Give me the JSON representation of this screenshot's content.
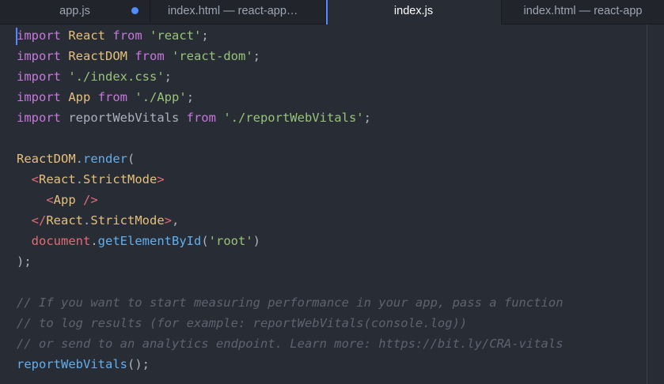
{
  "tabs": [
    {
      "label": "app.js",
      "modified": true,
      "active": false
    },
    {
      "label": "index.html — react-app₩p...",
      "modified": false,
      "active": false
    },
    {
      "label": "index.js",
      "modified": false,
      "active": true
    },
    {
      "label": "index.html — react-app",
      "modified": false,
      "active": false
    }
  ],
  "colors": {
    "background": "#282c34",
    "tabbar": "#21252b",
    "keyword": "#c678dd",
    "string": "#98c379",
    "identifier": "#e5c07b",
    "function": "#61afef",
    "tag": "#e06c75",
    "comment": "#5c6370",
    "cursor": "#528bff"
  },
  "code_lines": [
    [
      [
        "kw",
        "import"
      ],
      [
        "pun",
        " "
      ],
      [
        "var",
        "React"
      ],
      [
        "pun",
        " "
      ],
      [
        "kw",
        "from"
      ],
      [
        "pun",
        " "
      ],
      [
        "str",
        "'react'"
      ],
      [
        "pun",
        ";"
      ]
    ],
    [
      [
        "kw",
        "import"
      ],
      [
        "pun",
        " "
      ],
      [
        "var",
        "ReactDOM"
      ],
      [
        "pun",
        " "
      ],
      [
        "kw",
        "from"
      ],
      [
        "pun",
        " "
      ],
      [
        "str",
        "'react-dom'"
      ],
      [
        "pun",
        ";"
      ]
    ],
    [
      [
        "kw",
        "import"
      ],
      [
        "pun",
        " "
      ],
      [
        "str",
        "'./index.css'"
      ],
      [
        "pun",
        ";"
      ]
    ],
    [
      [
        "kw",
        "import"
      ],
      [
        "pun",
        " "
      ],
      [
        "var",
        "App"
      ],
      [
        "pun",
        " "
      ],
      [
        "kw",
        "from"
      ],
      [
        "pun",
        " "
      ],
      [
        "str",
        "'./App'"
      ],
      [
        "pun",
        ";"
      ]
    ],
    [
      [
        "kw",
        "import"
      ],
      [
        "pun",
        " reportWebVitals "
      ],
      [
        "kw",
        "from"
      ],
      [
        "pun",
        " "
      ],
      [
        "str",
        "'./reportWebVitals'"
      ],
      [
        "pun",
        ";"
      ]
    ],
    [],
    [
      [
        "var",
        "ReactDOM"
      ],
      [
        "pun",
        "."
      ],
      [
        "fn",
        "render"
      ],
      [
        "pun",
        "("
      ]
    ],
    [
      [
        "pun",
        "  "
      ],
      [
        "tag",
        "<"
      ],
      [
        "var",
        "React"
      ],
      [
        "pun",
        "."
      ],
      [
        "var",
        "StrictMode"
      ],
      [
        "tag",
        ">"
      ]
    ],
    [
      [
        "pun",
        "    "
      ],
      [
        "tag",
        "<"
      ],
      [
        "var",
        "App"
      ],
      [
        "pun",
        " "
      ],
      [
        "tag",
        "/>"
      ]
    ],
    [
      [
        "pun",
        "  "
      ],
      [
        "tag",
        "</"
      ],
      [
        "var",
        "React"
      ],
      [
        "pun",
        "."
      ],
      [
        "var",
        "StrictMode"
      ],
      [
        "tag",
        ">"
      ],
      [
        "pun",
        ","
      ]
    ],
    [
      [
        "pun",
        "  "
      ],
      [
        "tag",
        "document"
      ],
      [
        "pun",
        "."
      ],
      [
        "fn",
        "getElementById"
      ],
      [
        "pun",
        "("
      ],
      [
        "str",
        "'root'"
      ],
      [
        "pun",
        ")"
      ]
    ],
    [
      [
        "pun",
        ");"
      ]
    ],
    [],
    [
      [
        "cm",
        "// If you want to start measuring performance in your app, pass a function"
      ]
    ],
    [
      [
        "cm",
        "// to log results (for example: reportWebVitals(console.log))"
      ]
    ],
    [
      [
        "cm",
        "// or send to an analytics endpoint. Learn more: https://bit.ly/CRA-vitals"
      ]
    ],
    [
      [
        "fn",
        "reportWebVitals"
      ],
      [
        "pun",
        "();"
      ]
    ]
  ]
}
